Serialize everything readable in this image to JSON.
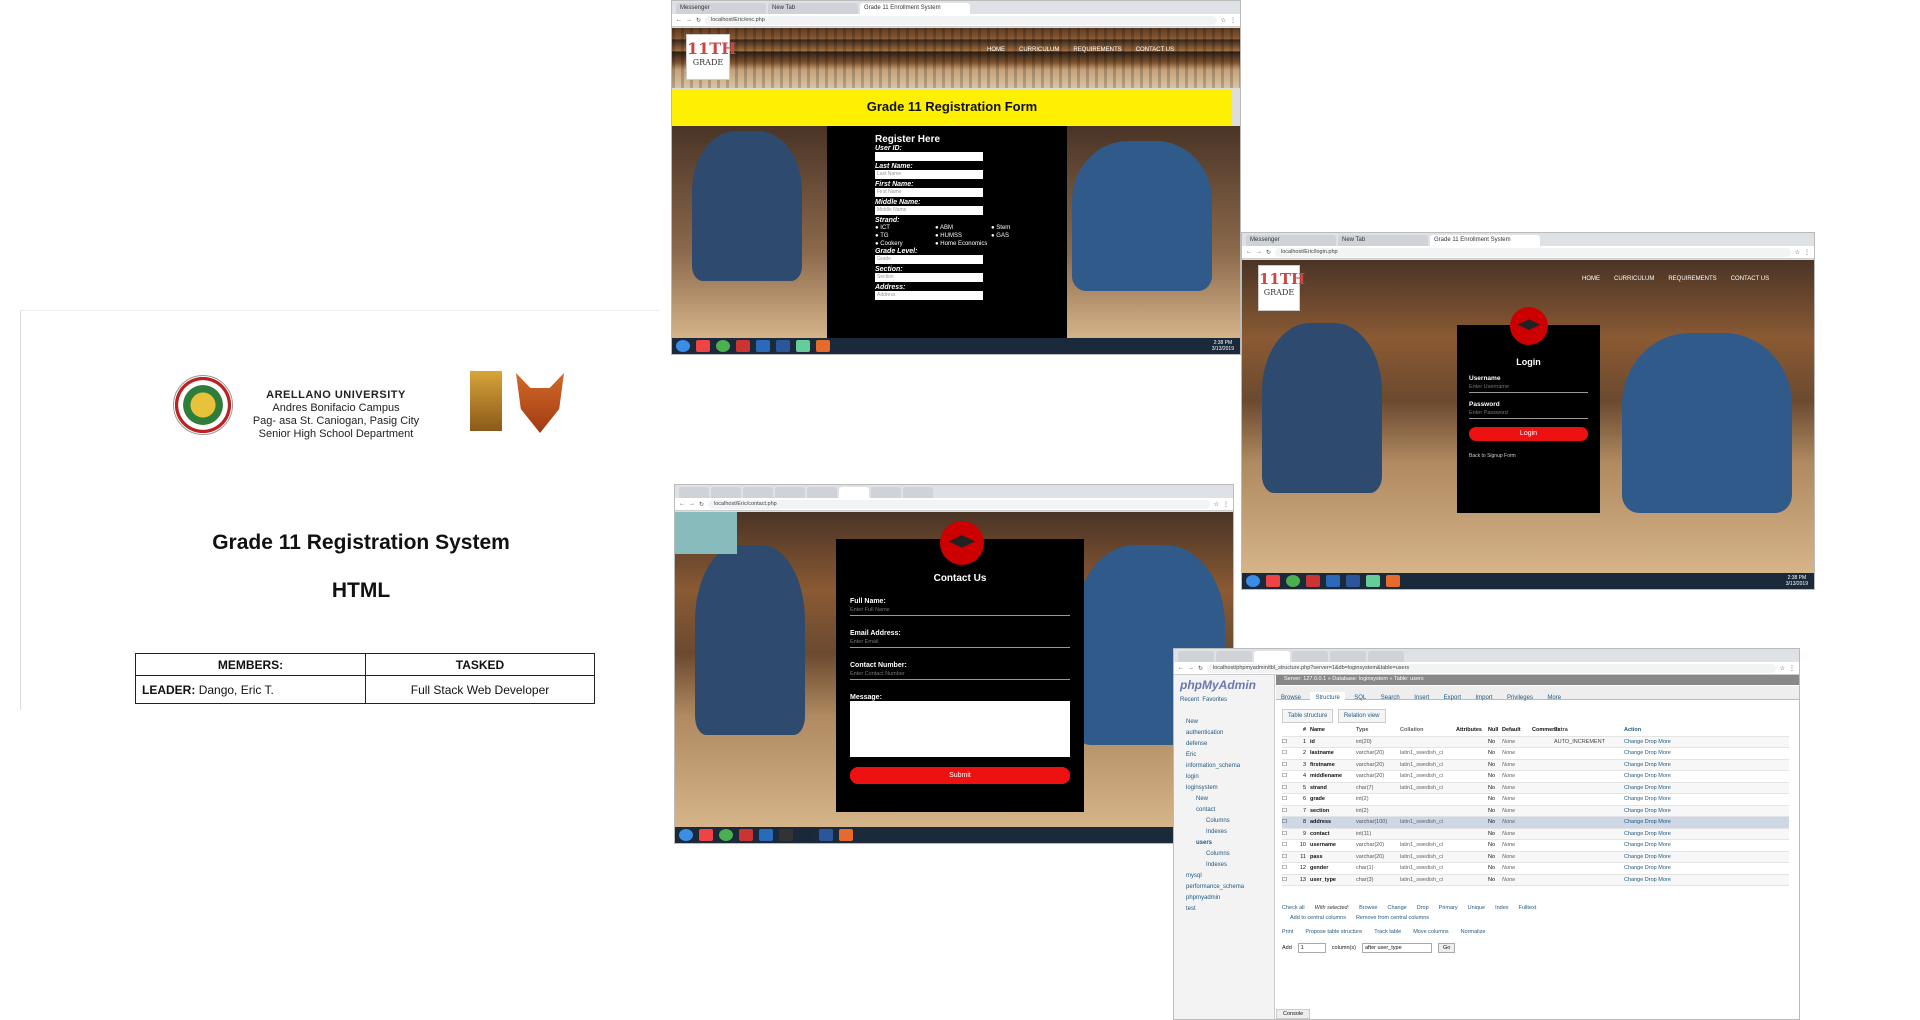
{
  "document": {
    "university": "ARELLANO UNIVERSITY",
    "campus": "Andres Bonifacio Campus",
    "address": "Pag- asa St. Caniogan, Pasig City",
    "department": "Senior High School Department",
    "title": "Grade 11 Registration System",
    "subtitle": "HTML",
    "table": {
      "col1": "MEMBERS:",
      "col2": "TASKED",
      "leader_label": "LEADER:",
      "leader_name": "Dango, Eric T.",
      "leader_task": "Full Stack Web Developer"
    }
  },
  "register_shot": {
    "tabs": [
      "Messenger",
      "New Tab",
      "Grade 11 Enrollment System"
    ],
    "url": "localhost/Eric/enc.php",
    "logo": "11TH",
    "logo_sub": "GRADE",
    "nav": [
      "HOME",
      "CURRICULUM",
      "REQUIREMENTS",
      "CONTACT US"
    ],
    "banner": "Grade 11 Registration Form",
    "heading": "Register Here",
    "fields": [
      {
        "label": "User ID:",
        "placeholder": ""
      },
      {
        "label": "Last Name:",
        "placeholder": "Last Name"
      },
      {
        "label": "First Name:",
        "placeholder": "First Name"
      },
      {
        "label": "Middle Name:",
        "placeholder": "Middle Name"
      }
    ],
    "strand_label": "Strand:",
    "strands": [
      "ICT",
      "ABM",
      "Stem",
      "TG",
      "HUMSS",
      "GAS",
      "Cookery",
      "Home Economics"
    ],
    "grade_label": "Grade Level:",
    "grade_ph": "Grade",
    "section_label": "Section:",
    "section_ph": "Section",
    "address_label": "Address:",
    "address_ph": "Address",
    "time": "2:38 PM",
    "date": "3/13/2019"
  },
  "login_shot": {
    "tabs": [
      "Messenger",
      "New Tab",
      "Grade 11 Enrollment System"
    ],
    "url": "localhost/Eric/login.php",
    "logo": "11TH",
    "logo_sub": "GRADE",
    "nav": [
      "HOME",
      "CURRICULUM",
      "REQUIREMENTS",
      "CONTACT US"
    ],
    "heading": "Login",
    "username_label": "Username",
    "username_ph": "Enter Username",
    "password_label": "Password",
    "password_ph": "Enter Password",
    "button": "Login",
    "back_link": "Back to Signup Form",
    "time": "2:38 PM",
    "date": "3/13/2019"
  },
  "contact_shot": {
    "url": "localhost/Eric/contact.php",
    "heading": "Contact Us",
    "fullname_label": "Full Name:",
    "fullname_ph": "Enter Full Name",
    "email_label": "Email Address:",
    "email_ph": "Enter Email",
    "contact_label": "Contact Number:",
    "contact_ph": "Enter Contact Number",
    "message_label": "Message:",
    "button": "Submit"
  },
  "pma_shot": {
    "url": "localhost/phpmyadmin/tbl_structure.php?server=1&db=loginsystem&table=users",
    "logo": "phpMyAdmin",
    "recent": "Recent",
    "favorites": "Favorites",
    "breadcrumb": "Server: 127.0.0.1 » Database: loginsystem » Table: users",
    "tabs": [
      "Browse",
      "Structure",
      "SQL",
      "Search",
      "Insert",
      "Export",
      "Import",
      "Privileges",
      "More"
    ],
    "subtabs": [
      "Table structure",
      "Relation view"
    ],
    "tree": [
      "New",
      "authentication",
      "defense",
      "Eric",
      "information_schema",
      "login",
      "loginsystem",
      "New",
      "contact",
      "Columns",
      "Indexes",
      "users",
      "Columns",
      "Indexes",
      "mysql",
      "performance_schema",
      "phpmyadmin",
      "test"
    ],
    "headers": [
      "#",
      "Name",
      "Type",
      "Collation",
      "Attributes",
      "Null",
      "Default",
      "Comments",
      "Extra",
      "Action"
    ],
    "rows": [
      {
        "no": "1",
        "name": "id",
        "type": "int(20)",
        "coll": "",
        "def": "None",
        "extra": "AUTO_INCREMENT"
      },
      {
        "no": "2",
        "name": "lastname",
        "type": "varchar(20)",
        "coll": "latin1_swedish_ci",
        "def": "None",
        "extra": ""
      },
      {
        "no": "3",
        "name": "firstname",
        "type": "varchar(20)",
        "coll": "latin1_swedish_ci",
        "def": "None",
        "extra": ""
      },
      {
        "no": "4",
        "name": "middlename",
        "type": "varchar(20)",
        "coll": "latin1_swedish_ci",
        "def": "None",
        "extra": ""
      },
      {
        "no": "5",
        "name": "strand",
        "type": "char(7)",
        "coll": "latin1_swedish_ci",
        "def": "None",
        "extra": ""
      },
      {
        "no": "6",
        "name": "grade",
        "type": "int(2)",
        "coll": "",
        "def": "None",
        "extra": ""
      },
      {
        "no": "7",
        "name": "section",
        "type": "int(2)",
        "coll": "",
        "def": "None",
        "extra": ""
      },
      {
        "no": "8",
        "name": "address",
        "type": "varchar(100)",
        "coll": "latin1_swedish_ci",
        "def": "None",
        "extra": ""
      },
      {
        "no": "9",
        "name": "contact",
        "type": "int(11)",
        "coll": "",
        "def": "None",
        "extra": ""
      },
      {
        "no": "10",
        "name": "username",
        "type": "varchar(20)",
        "coll": "latin1_swedish_ci",
        "def": "None",
        "extra": ""
      },
      {
        "no": "11",
        "name": "pass",
        "type": "varchar(20)",
        "coll": "latin1_swedish_ci",
        "def": "None",
        "extra": ""
      },
      {
        "no": "12",
        "name": "gender",
        "type": "char(1)",
        "coll": "latin1_swedish_ci",
        "def": "None",
        "extra": ""
      },
      {
        "no": "13",
        "name": "user_type",
        "type": "char(3)",
        "coll": "latin1_swedish_ci",
        "def": "None",
        "extra": ""
      }
    ],
    "null_val": "No",
    "action": "Change  Drop  More",
    "footer": [
      "Check all",
      "With selected:",
      "Browse",
      "Change",
      "Drop",
      "Primary",
      "Unique",
      "Index",
      "Fulltext"
    ],
    "footer2": [
      "Print",
      "Propose table structure",
      "Track table",
      "Move columns",
      "Normalize"
    ],
    "add_label": "Add",
    "add_value": "1",
    "add_suffix": "column(s)",
    "after_select": "after user_type",
    "go": "Go",
    "add_central": "Add to central columns",
    "remove_central": "Remove from central columns",
    "console": "Console"
  }
}
